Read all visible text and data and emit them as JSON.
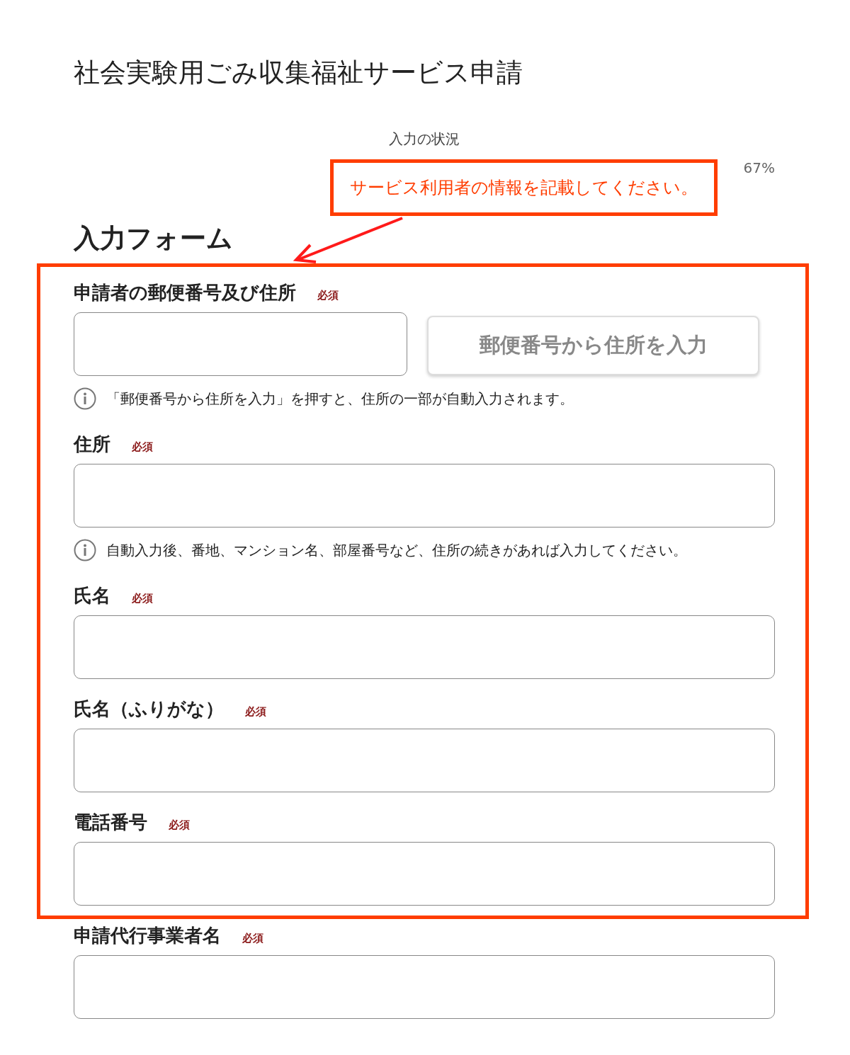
{
  "title": "社会実験用ごみ収集福祉サービス申請",
  "progress": {
    "label": "入力の状況",
    "percent": "67%"
  },
  "annotation": {
    "text": "サービス利用者の情報を記載してください。"
  },
  "form": {
    "heading": "入力フォーム",
    "fields": [
      {
        "label": "申請者の郵便番号及び住所",
        "required": "必須",
        "kind": "postal",
        "button": "郵便番号から住所を入力",
        "note": "「郵便番号から住所を入力」を押すと、住所の一部が自動入力されます。",
        "highlighted": true
      },
      {
        "label": "住所",
        "required": "必須",
        "kind": "text",
        "note": "自動入力後、番地、マンション名、部屋番号など、住所の続きがあれば入力してください。",
        "highlighted": true
      },
      {
        "label": "氏名",
        "required": "必須",
        "kind": "text",
        "highlighted": true
      },
      {
        "label": "氏名（ふりがな）",
        "required": "必須",
        "kind": "text",
        "highlighted": true
      },
      {
        "label": "電話番号",
        "required": "必須",
        "kind": "text",
        "highlighted": true
      },
      {
        "label": "申請代行事業者名",
        "required": "必須",
        "kind": "text",
        "highlighted": false
      }
    ]
  }
}
